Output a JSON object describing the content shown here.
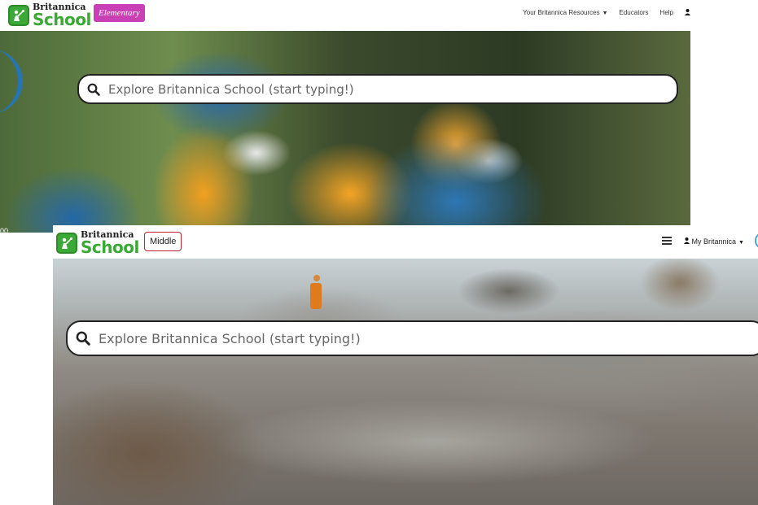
{
  "elementary": {
    "logo": {
      "line1": "Britannica",
      "line2": "School"
    },
    "level_badge": "Elementary",
    "nav": {
      "resources": "Your Britannica Resources",
      "educators": "Educators",
      "help": "Help"
    },
    "search": {
      "placeholder": "Explore Britannica School (start typing!)"
    },
    "edge_mark": "00"
  },
  "middle": {
    "logo": {
      "line1": "Britannica",
      "line2": "School"
    },
    "level_badge": "Middle",
    "nav": {
      "account": "My Britannica"
    },
    "search": {
      "placeholder": "Explore Britannica School (start typing!)"
    }
  },
  "colors": {
    "brand_green": "#3aa935",
    "elementary_badge": "#c93fb5",
    "middle_badge_border": "#c0272d"
  },
  "icons": [
    "search-icon",
    "menu-icon",
    "user-icon",
    "caret-down-icon",
    "logo-icon"
  ]
}
